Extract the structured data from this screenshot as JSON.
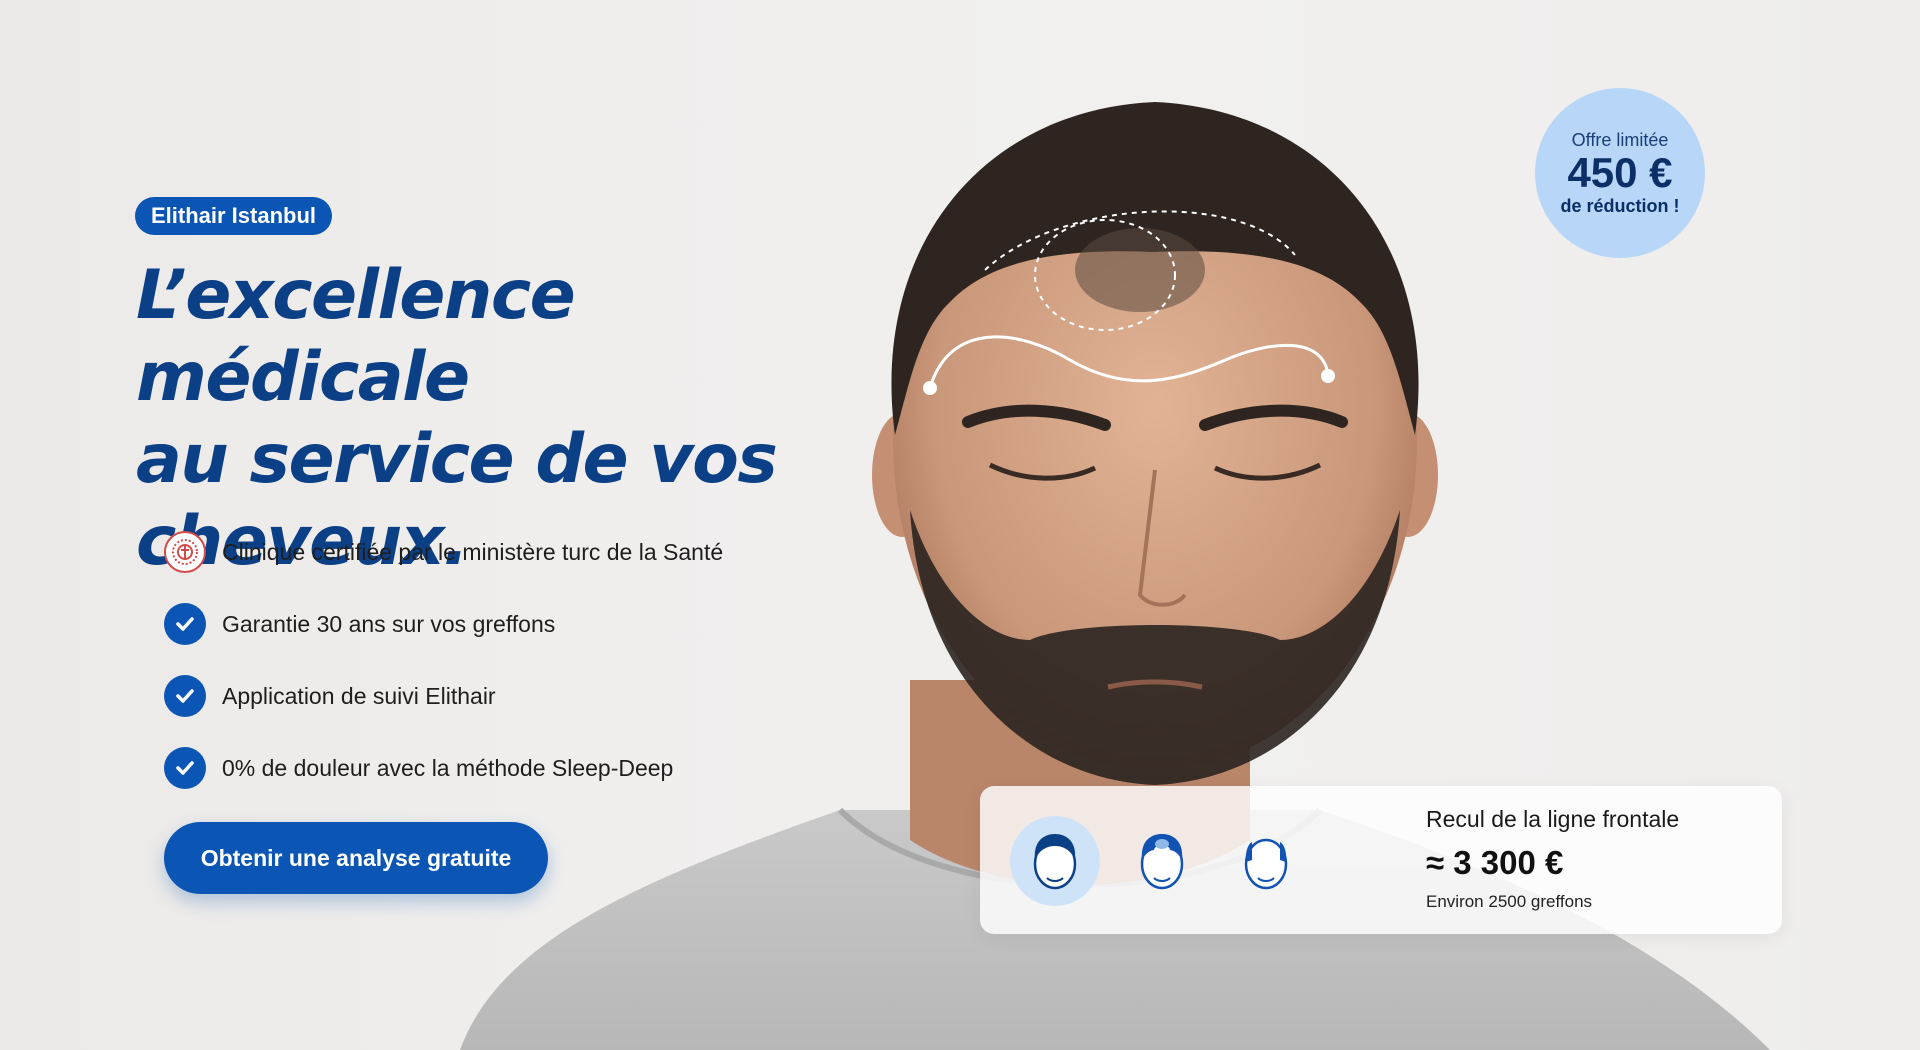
{
  "hero": {
    "badge": "Elithair Istanbul",
    "headline_line1": "L’excellence médicale",
    "headline_line2": "au service de vos",
    "headline_line3": "cheveux."
  },
  "features": [
    {
      "icon": "ministry-seal-icon",
      "text": "Clinique certifiée par le ministère turc de la Santé"
    },
    {
      "icon": "check-icon",
      "text": "Garantie 30 ans sur vos greffons"
    },
    {
      "icon": "check-icon",
      "text": "Application de suivi Elithair"
    },
    {
      "icon": "check-icon",
      "text": "0% de douleur avec la méthode Sleep-Deep"
    }
  ],
  "cta": {
    "label": "Obtenir une analyse gratuite"
  },
  "promo": {
    "label": "Offre limitée",
    "amount": "450 €",
    "sub": "de réduction !"
  },
  "price_card": {
    "stages": [
      {
        "icon": "full-hair-head-icon",
        "selected": true
      },
      {
        "icon": "crown-thinning-head-icon",
        "selected": false
      },
      {
        "icon": "advanced-baldness-head-icon",
        "selected": false
      }
    ],
    "title": "Recul de la ligne frontale",
    "price": "≈ 3 300 €",
    "grafts": "Environ 2500 greffons"
  },
  "colors": {
    "brand_blue": "#0b55b4",
    "headline_navy": "#0b3f86",
    "promo_bg": "#b7d6f8",
    "selected_stage_bg": "#cfe3f8"
  }
}
